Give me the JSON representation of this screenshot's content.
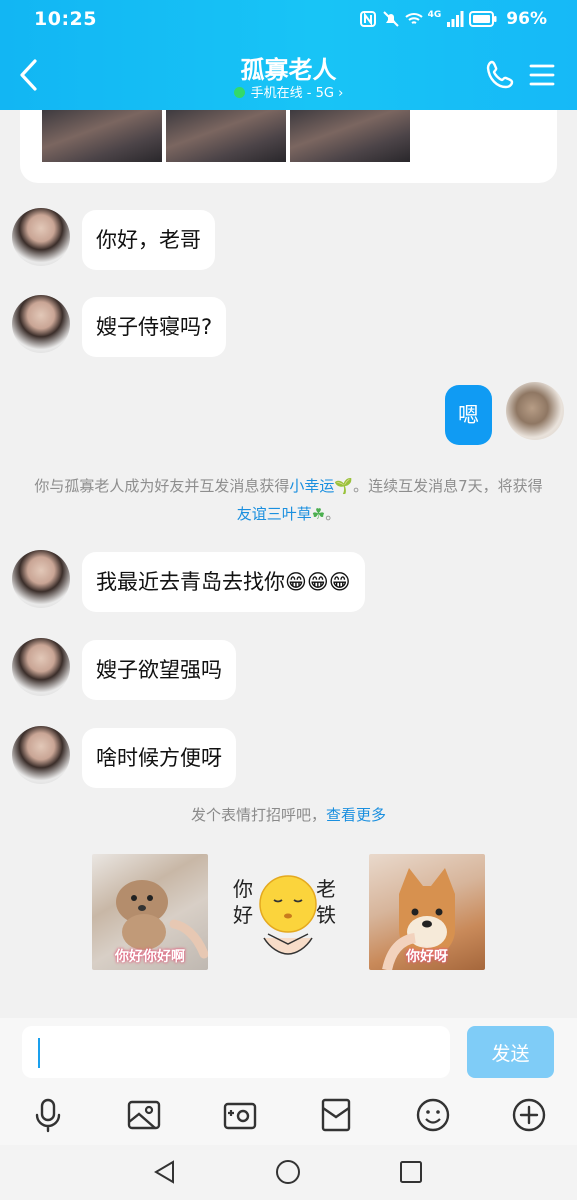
{
  "status_bar": {
    "time": "10:25",
    "signal_label": "4G",
    "battery": "96%"
  },
  "header": {
    "title": "孤寡老人",
    "subtitle": "手机在线 - 5G",
    "subtitle_chevron": "›",
    "online_color": "#33d96b"
  },
  "messages": [
    {
      "side": "left",
      "text": "你好，老哥"
    },
    {
      "side": "left",
      "text": "嫂子侍寝吗?"
    },
    {
      "side": "right",
      "text": "嗯"
    },
    {
      "side": "left",
      "text": "我最近去青岛去找你😁😁😁"
    },
    {
      "side": "left",
      "text": "嫂子欲望强吗"
    },
    {
      "side": "left",
      "text": "啥时候方便呀"
    }
  ],
  "system_note": {
    "part1": "你与孤寡老人成为好友并互发消息获得",
    "link1": "小幸运",
    "part2": "。连续互发消息7天，将获得",
    "link2": "友谊三叶草",
    "part3": "。",
    "sprout_icon": "🌱",
    "clover_icon": "☘"
  },
  "sticker_tip": {
    "text": "发个表情打招呼吧，",
    "more": "查看更多"
  },
  "stickers": [
    {
      "caption": "你好你好啊"
    },
    {
      "left_text": "你\n好",
      "right_text": "老\n铁"
    },
    {
      "caption": "你好呀"
    }
  ],
  "input": {
    "placeholder": "",
    "value": "",
    "send_label": "发送"
  },
  "toolbar_icons": [
    "microphone-icon",
    "image-icon",
    "camera-icon",
    "red-packet-icon",
    "emoji-icon",
    "plus-icon"
  ],
  "colors": {
    "header": "#16b9f7",
    "bubble_mine": "#109bf3",
    "link": "#1a8fdf",
    "send_disabled": "#7fccf7"
  }
}
